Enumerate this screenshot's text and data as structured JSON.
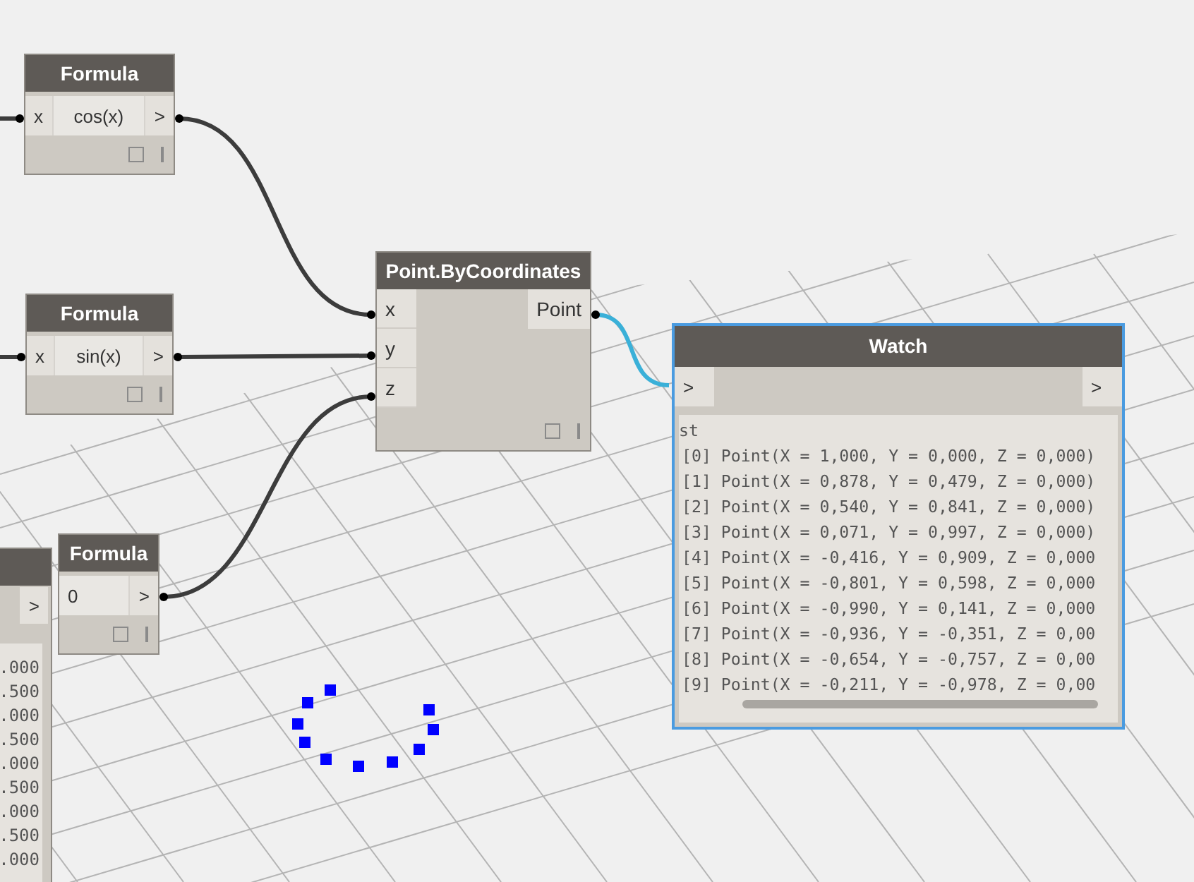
{
  "nodes": [
    {
      "kind": "formula",
      "title": "Formula",
      "input_port": "x",
      "value": "cos(x)",
      "output_port": ">"
    },
    {
      "kind": "formula",
      "title": "Formula",
      "input_port": "x",
      "value": "sin(x)",
      "output_port": ">"
    },
    {
      "kind": "number",
      "title": "Formula",
      "value": "0",
      "output_port": ">"
    },
    {
      "kind": "function",
      "title": "Point.ByCoordinates",
      "input_ports": [
        "x",
        "y",
        "z"
      ],
      "output_port": "Point"
    }
  ],
  "partial_node": {
    "output_port": ">",
    "values": [
      ".000",
      ".500",
      ".000",
      ".500",
      ".000",
      ".500",
      ".000",
      ".500",
      ".000"
    ]
  },
  "watch": {
    "title": "Watch",
    "selected": true,
    "input_port": ">",
    "output_port": ">",
    "list_header": "st",
    "rows": [
      "[0] Point(X = 1,000, Y = 0,000, Z = 0,000)",
      "[1] Point(X = 0,878, Y = 0,479, Z = 0,000)",
      "[2] Point(X = 0,540, Y = 0,841, Z = 0,000)",
      "[3] Point(X = 0,071, Y = 0,997, Z = 0,000)",
      "[4] Point(X = -0,416, Y = 0,909, Z = 0,000",
      "[5] Point(X = -0,801, Y = 0,598, Z = 0,000",
      "[6] Point(X = -0,990, Y = 0,141, Z = 0,000",
      "[7] Point(X = -0,936, Y = -0,351, Z = 0,00",
      "[8] Point(X = -0,654, Y = -0,757, Z = 0,00",
      "[9] Point(X = -0,211, Y = -0,978, Z = 0,00"
    ]
  }
}
